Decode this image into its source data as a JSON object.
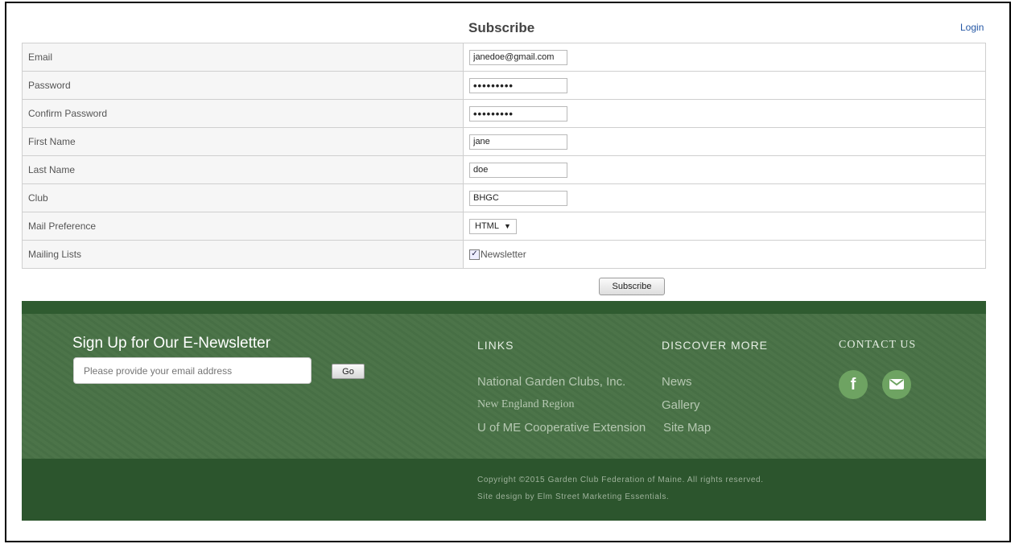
{
  "page": {
    "title": "Subscribe",
    "login_label": "Login"
  },
  "form": {
    "rows": [
      {
        "label": "Email",
        "value": "janedoe@gmail.com"
      },
      {
        "label": "Password",
        "value": "•••••••••"
      },
      {
        "label": "Confirm Password",
        "value": "•••••••••"
      },
      {
        "label": "First Name",
        "value": "jane"
      },
      {
        "label": "Last Name",
        "value": "doe"
      },
      {
        "label": "Club",
        "value": "BHGC"
      },
      {
        "label": "Mail Preference",
        "value": "HTML"
      },
      {
        "label": "Mailing Lists",
        "value": "Newsletter"
      }
    ],
    "newsletter_checked": true,
    "submit_label": "Subscribe"
  },
  "footer": {
    "signup": {
      "title": "Sign Up for Our E-Newsletter",
      "placeholder": "Please provide your email address",
      "go_label": "Go"
    },
    "links": {
      "heading": "LINKS",
      "items": [
        "National Garden Clubs, Inc.",
        "New England Region",
        "U of ME Cooperative Extension"
      ]
    },
    "discover": {
      "heading": "DISCOVER MORE",
      "items": [
        "News",
        "Gallery",
        "Site Map"
      ]
    },
    "contact": {
      "heading": "CONTACT US",
      "icons": [
        "facebook-icon",
        "mail-icon"
      ]
    },
    "copyright": "Copyright ©2015 Garden Club Federation of Maine. All rights reserved.",
    "credit": "Site design by Elm Street Marketing Essentials."
  },
  "colors": {
    "footer_dark": "#2c552d",
    "footer_texture": "#4a7247",
    "social_green": "#6ea362",
    "link_blue": "#2457a5"
  }
}
